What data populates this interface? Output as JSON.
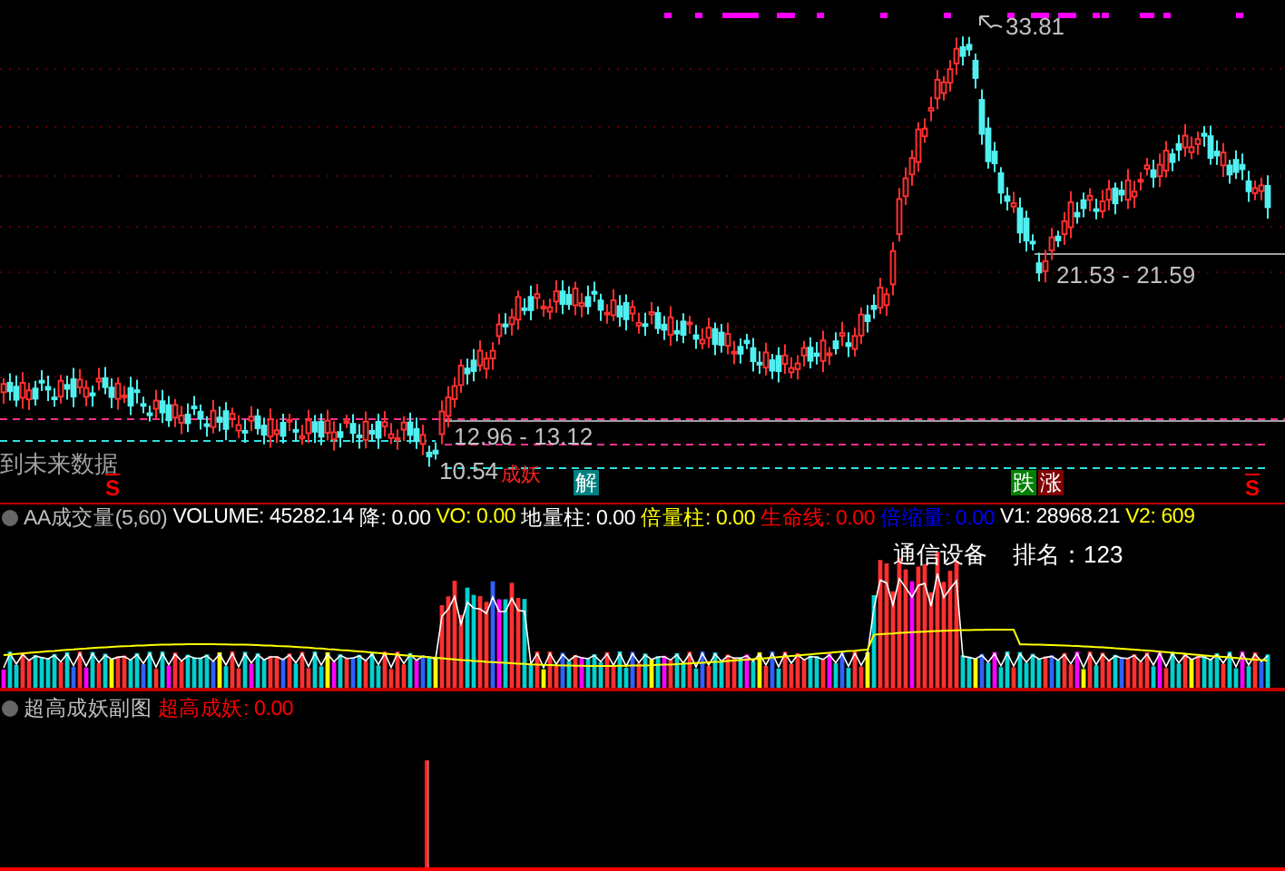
{
  "main_chart": {
    "high_label": "33.81",
    "range_labels": [
      "21.53 - 21.59",
      "12.96 - 13.12"
    ],
    "low_label": "10.54",
    "low_tag": "成妖",
    "future_label": "到未来数据",
    "signals": [
      {
        "text": "S",
        "kind": "arrow",
        "color": "#ff0000"
      },
      {
        "text": "解",
        "kind": "tag",
        "color": "#008080"
      },
      {
        "text": "跌",
        "kind": "tag",
        "color": "#008000"
      },
      {
        "text": "涨",
        "kind": "tag",
        "color": "#800000"
      },
      {
        "text": "S",
        "kind": "arrow",
        "color": "#ff0000"
      }
    ]
  },
  "volume_panel": {
    "name": "AA成交量(5,60)",
    "values": [
      {
        "text": "VOLUME: 45282.14",
        "color": "#ffffff"
      },
      {
        "text": "降: 0.00",
        "color": "#ffffff"
      },
      {
        "text": "VO: 0.00",
        "color": "#ffff00"
      },
      {
        "text": "地量柱: 0.00",
        "color": "#ffffff"
      },
      {
        "text": "倍量柱: 0.00",
        "color": "#ffff00"
      },
      {
        "text": "生命线: 0.00",
        "color": "#ff0000"
      },
      {
        "text": "倍缩量: 0.00",
        "color": "#0000ff"
      },
      {
        "text": "V1: 28968.21",
        "color": "#ffffff"
      },
      {
        "text": "V2: 609",
        "color": "#ffff00"
      }
    ],
    "industry": "通信设备",
    "rank": "排名：123"
  },
  "sub_panel": {
    "name": "超高成妖副图",
    "values": [
      {
        "text": "超高成妖: 0.00",
        "color": "#ff0000"
      }
    ]
  }
}
